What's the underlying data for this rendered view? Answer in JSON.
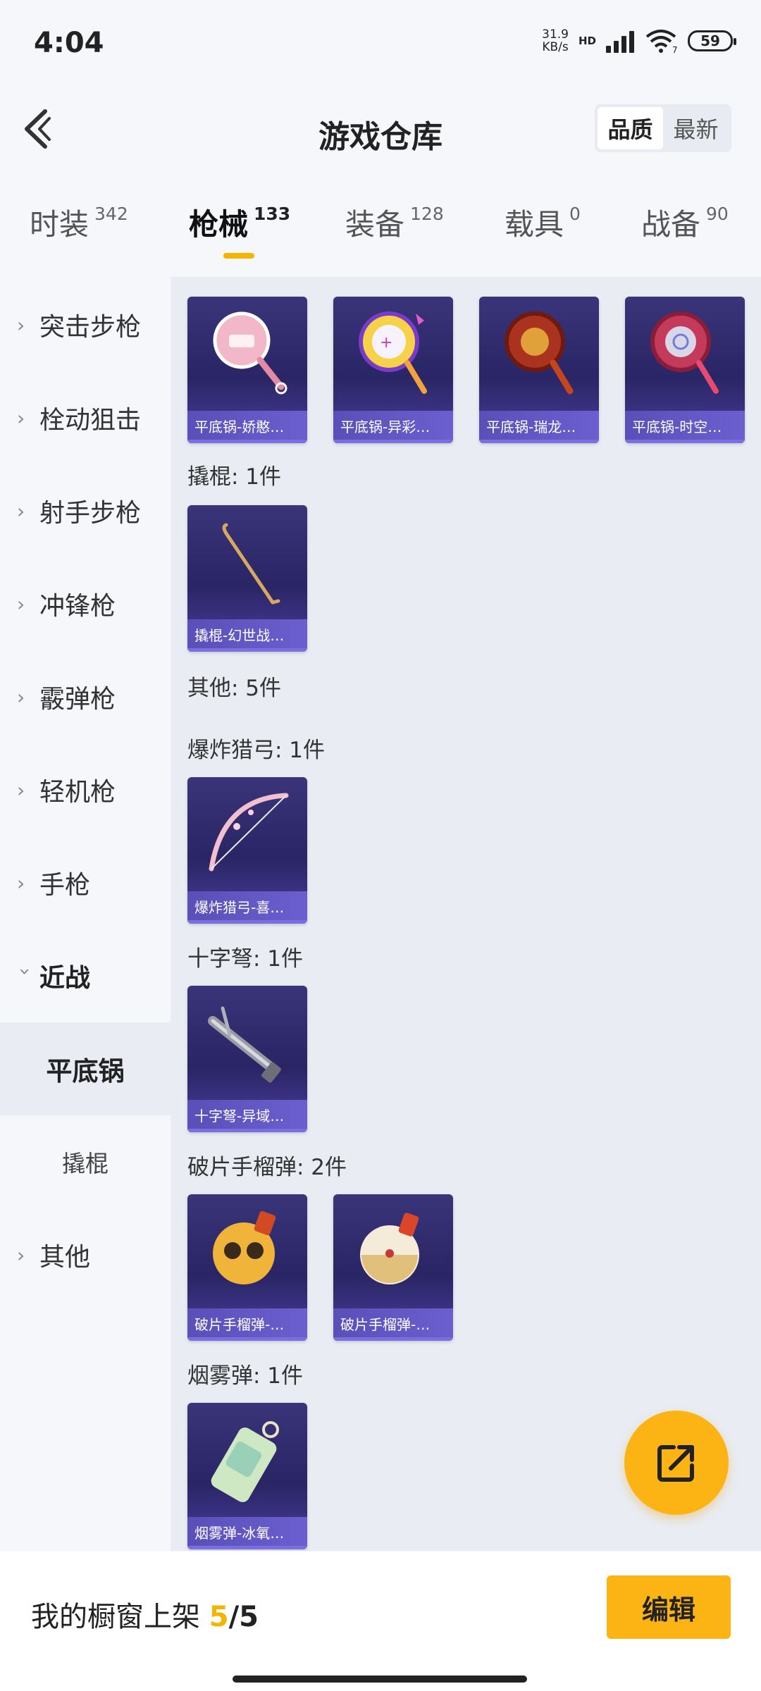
{
  "status": {
    "time": "4:04",
    "net_speed": "31.9",
    "net_unit": "KB/s",
    "hd": "HD",
    "wifi_badge": "7",
    "battery": "59"
  },
  "header": {
    "title": "游戏仓库",
    "sort_options": [
      "品质",
      "最新"
    ],
    "sort_selected": "品质"
  },
  "tabs": [
    {
      "label": "时装",
      "count": "342"
    },
    {
      "label": "枪械",
      "count": "133",
      "active": true
    },
    {
      "label": "装备",
      "count": "128"
    },
    {
      "label": "载具",
      "count": "0"
    },
    {
      "label": "战备",
      "count": "90"
    }
  ],
  "sidebar": {
    "categories": [
      "突击步枪",
      "栓动狙击",
      "射手步枪",
      "冲锋枪",
      "霰弹枪",
      "轻机枪",
      "手枪",
      "近战",
      "其他"
    ],
    "open_category": "近战",
    "subcategories": [
      "平底锅",
      "撬棍"
    ],
    "active_subcategory": "平底锅"
  },
  "content": {
    "pan_cards": [
      "平底锅-娇憨…",
      "平底锅-异彩…",
      "平底锅-瑞龙…",
      "平底锅-时空…"
    ],
    "groups": [
      {
        "title": "撬棍: 1件",
        "cards": [
          "撬棍-幻世战…"
        ]
      },
      {
        "title": "其他: 5件",
        "cards": []
      },
      {
        "title": "爆炸猎弓: 1件",
        "cards": [
          "爆炸猎弓-喜…"
        ]
      },
      {
        "title": "十字弩: 1件",
        "cards": [
          "十字弩-异域…"
        ]
      },
      {
        "title": "破片手榴弹: 2件",
        "cards": [
          "破片手榴弹-…",
          "破片手榴弹-…"
        ]
      },
      {
        "title": "烟雾弹: 1件",
        "cards": [
          "烟雾弹-冰氧…"
        ]
      }
    ]
  },
  "bottom": {
    "showcase_label": "我的橱窗上架",
    "showcase_current": "5",
    "showcase_total": "/5",
    "edit_label": "编辑"
  },
  "colors": {
    "accent": "#fbb414",
    "card_bg": "#2a2565",
    "card_caption": "#5a4fb8"
  }
}
